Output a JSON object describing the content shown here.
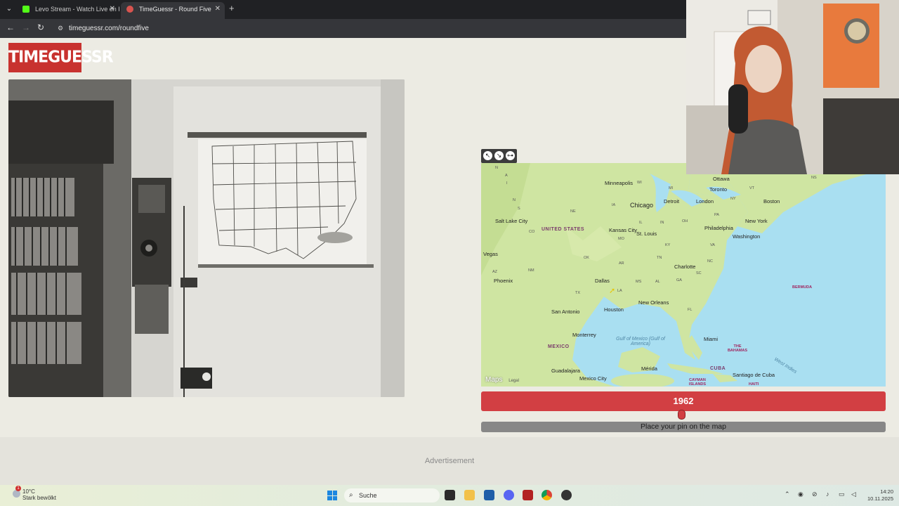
{
  "browser": {
    "tabs": [
      {
        "title": "Levo Stream - Watch Live on Ki",
        "favicon_color": "#53fc18"
      },
      {
        "title": "TimeGuessr - Round Five",
        "favicon_color": "#d8544f"
      }
    ],
    "url": "timeguessr.com/roundfive"
  },
  "page": {
    "logo": "TIMEGUESSR",
    "year_value": "1962",
    "pin_prompt": "Place your pin on the map",
    "advertisement": "Advertisement"
  },
  "map": {
    "brand": "Maps",
    "legal": "Legal",
    "countries": [
      "UNITED STATES",
      "MEXICO",
      "CUBA",
      "THE BAHAMAS",
      "BERMUDA",
      "CAYMAN ISLANDS",
      "HAITI"
    ],
    "cities": [
      "Minneapolis",
      "Chicago",
      "Detroit",
      "Toronto",
      "Ottawa",
      "Boston",
      "New York",
      "Philadelphia",
      "Washington",
      "London",
      "Salt Lake City",
      "Kansas City",
      "St. Louis",
      "Charlotte",
      "Dallas",
      "Houston",
      "San Antonio",
      "New Orleans",
      "Phoenix",
      "Vegas",
      "Monterrey",
      "Miami",
      "Guadalajara",
      "Mexico City",
      "Mérida",
      "Santiago de Cuba"
    ],
    "states": [
      "WI",
      "MI",
      "NY",
      "VT",
      "NS",
      "IA",
      "IL",
      "IN",
      "OH",
      "PA",
      "NE",
      "MO",
      "KY",
      "VA",
      "CO",
      "OK",
      "AR",
      "TN",
      "NC",
      "NM",
      "AZ",
      "MS",
      "AL",
      "GA",
      "SC",
      "TX",
      "LA",
      "FL"
    ],
    "water": "Gulf of Mexico (Gulf of America)",
    "partial": [
      "N",
      "A",
      "I",
      "N",
      "S",
      "West Indies"
    ]
  },
  "taskbar": {
    "weather_temp": "10°C",
    "weather_desc": "Stark bewölkt",
    "weather_badge": "1",
    "search_placeholder": "Suche",
    "time": "14:20",
    "date": "10.11.2025"
  }
}
